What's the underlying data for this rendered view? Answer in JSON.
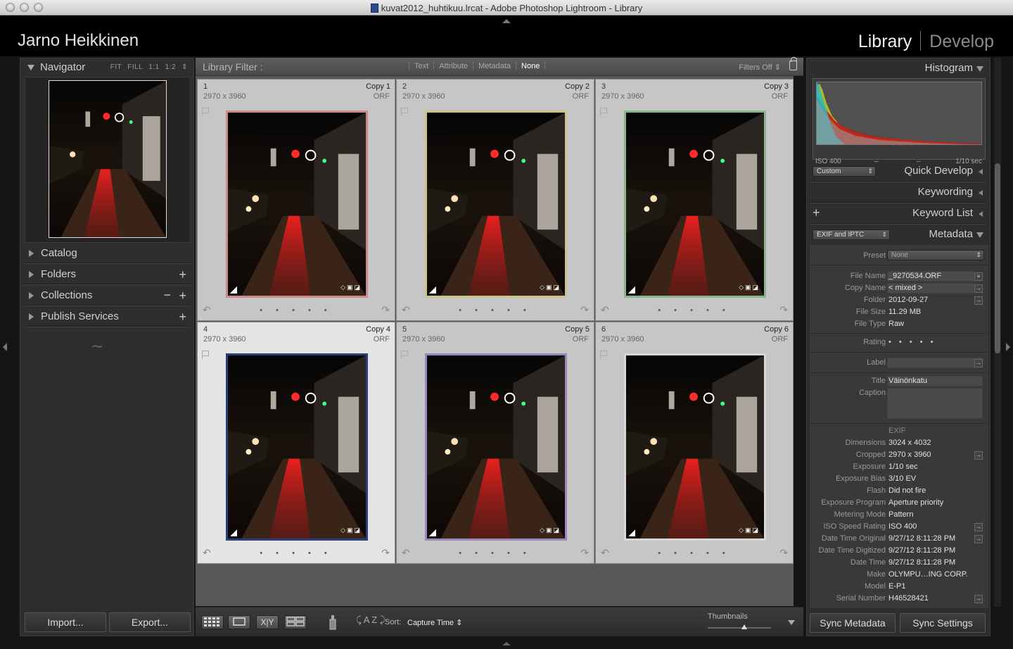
{
  "window": {
    "title": "kuvat2012_huhtikuu.lrcat - Adobe Photoshop Lightroom - Library"
  },
  "identity_plate": "Jarno Heikkinen",
  "modules": {
    "library": "Library",
    "develop": "Develop"
  },
  "left": {
    "navigator": {
      "title": "Navigator",
      "zoom": [
        "FIT",
        "FILL",
        "1:1",
        "1:2"
      ]
    },
    "catalog": "Catalog",
    "folders": "Folders",
    "collections": "Collections",
    "publish": "Publish Services",
    "import_label": "Import...",
    "export_label": "Export..."
  },
  "filter": {
    "title": "Library Filter :",
    "options": [
      "Text",
      "Attribute",
      "Metadata",
      "None"
    ],
    "active": "None",
    "filters_off": "Filters Off"
  },
  "grid": {
    "cells": [
      {
        "num": "1",
        "dims": "2970 x 3960",
        "copy": "Copy 1",
        "ext": "ORF",
        "frame": "#c88a8a"
      },
      {
        "num": "2",
        "dims": "2970 x 3960",
        "copy": "Copy 2",
        "ext": "ORF",
        "frame": "#c8c48a"
      },
      {
        "num": "3",
        "dims": "2970 x 3960",
        "copy": "Copy 3",
        "ext": "ORF",
        "frame": "#8ab58a"
      },
      {
        "num": "4",
        "dims": "2970 x 3960",
        "copy": "Copy 4",
        "ext": "ORF",
        "frame": "#2a3f7a"
      },
      {
        "num": "5",
        "dims": "2970 x 3960",
        "copy": "Copy 5",
        "ext": "ORF",
        "frame": "#9a88bd"
      },
      {
        "num": "6",
        "dims": "2970 x 3960",
        "copy": "Copy 6",
        "ext": "ORF",
        "frame": "#d8d8d8"
      }
    ],
    "rating_dots": "• • • • •"
  },
  "toolbar": {
    "sort_label": "Sort:",
    "sort_value": "Capture Time",
    "thumbnails_label": "Thumbnails"
  },
  "right": {
    "histogram": {
      "title": "Histogram",
      "iso": "ISO 400",
      "dash1": "–",
      "dash2": "–",
      "shutter": "1/10 sec"
    },
    "quick_develop": {
      "title": "Quick Develop",
      "preset": "Custom"
    },
    "keywording": "Keywording",
    "keyword_list": "Keyword List",
    "metadata": {
      "title": "Metadata",
      "set": "EXIF and IPTC",
      "preset_label": "Preset",
      "preset_value": "None",
      "rows": [
        {
          "k": "File Name",
          "v": "_9270534.ORF"
        },
        {
          "k": "Copy Name",
          "v": "< mixed >"
        },
        {
          "k": "Folder",
          "v": "2012-09-27"
        },
        {
          "k": "File Size",
          "v": "11.29 MB"
        },
        {
          "k": "File Type",
          "v": "Raw"
        }
      ],
      "rating_label": "Rating",
      "rating_dots": "• • • • •",
      "label_label": "Label",
      "title_label": "Title",
      "title_value": "Väinönkatu",
      "caption_label": "Caption",
      "exif_header": "EXIF",
      "exif_rows": [
        {
          "k": "Dimensions",
          "v": "3024 x 4032"
        },
        {
          "k": "Cropped",
          "v": "2970 x 3960"
        },
        {
          "k": "Exposure",
          "v": "1/10 sec"
        },
        {
          "k": "Exposure Bias",
          "v": "3/10 EV"
        },
        {
          "k": "Flash",
          "v": "Did not fire"
        },
        {
          "k": "Exposure Program",
          "v": "Aperture priority"
        },
        {
          "k": "Metering Mode",
          "v": "Pattern"
        },
        {
          "k": "ISO Speed Rating",
          "v": "ISO 400"
        },
        {
          "k": "Date Time Original",
          "v": "9/27/12 8:11:28 PM"
        },
        {
          "k": "Date Time Digitized",
          "v": "9/27/12 8:11:28 PM"
        },
        {
          "k": "Date Time",
          "v": "9/27/12 8:11:28 PM"
        },
        {
          "k": "Make",
          "v": "OLYMPU…ING CORP."
        },
        {
          "k": "Model",
          "v": "E-P1"
        },
        {
          "k": "Serial Number",
          "v": "H46528421"
        }
      ]
    },
    "sync_metadata": "Sync Metadata",
    "sync_settings": "Sync Settings"
  }
}
